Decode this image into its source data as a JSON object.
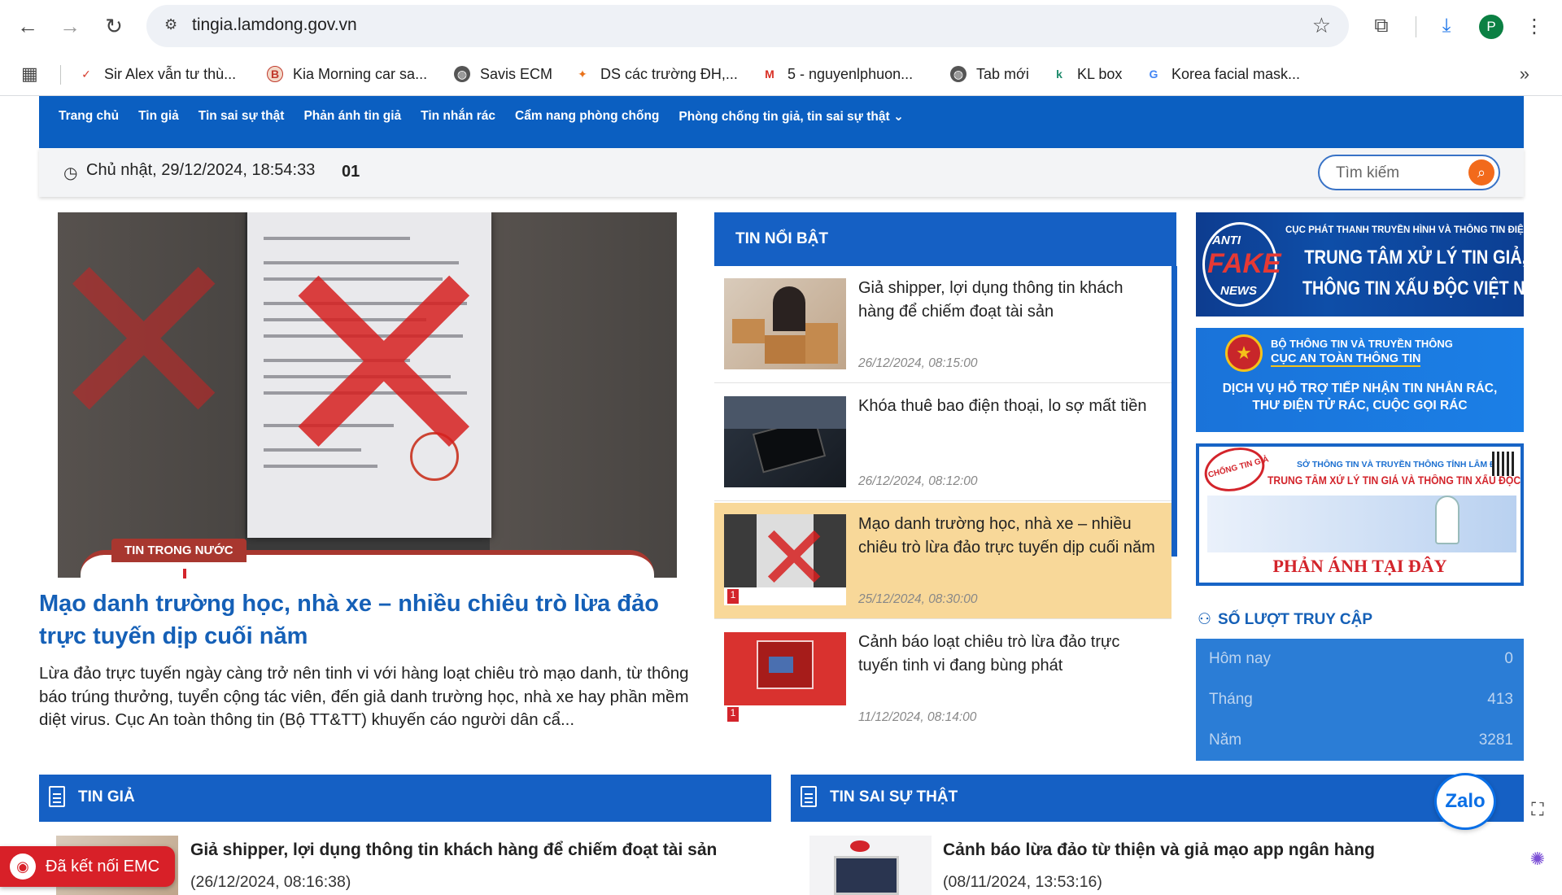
{
  "browser": {
    "url": "tingia.lamdong.gov.vn",
    "profile_initial": "P",
    "bookmarks": [
      {
        "label": "Sir Alex vẫn tư thù...",
        "icon": "check-icon"
      },
      {
        "label": "Kia Morning car sa...",
        "icon": "b-icon"
      },
      {
        "label": "Savis ECM",
        "icon": "globe-icon"
      },
      {
        "label": "DS các trường ĐH,...",
        "icon": "flame-icon"
      },
      {
        "label": "5 - nguyenlphuon...",
        "icon": "gmail-icon"
      },
      {
        "label": "Tab mới",
        "icon": "globe-icon"
      },
      {
        "label": "KL box",
        "icon": "k-icon"
      },
      {
        "label": "Korea facial mask...",
        "icon": "google-icon"
      }
    ]
  },
  "menu": [
    "Trang chủ",
    "Tin giả",
    "Tin sai sự thật",
    "Phản ánh tin giả",
    "Tin nhắn rác",
    "Cẩm nang phòng chống",
    "Phòng chống tin giả, tin sai sự thật"
  ],
  "datebar": {
    "datetime": "Chủ nhật, 29/12/2024, 18:54:33",
    "counter": "01",
    "search_placeholder": "Tìm kiếm"
  },
  "feature": {
    "category": "TIN TRONG NƯỚC",
    "title": "Mạo danh trường học, nhà xe – nhiều chiêu trò lừa đảo trực tuyến dịp cuối năm",
    "description": "Lừa đảo trực tuyến ngày càng trở nên tinh vi với hàng loạt chiêu trò mạo danh, từ thông báo trúng thưởng, tuyển cộng tác viên, đến giả danh trường học, nhà xe hay phần mềm diệt virus. Cục An toàn thông tin (Bộ TT&TT) khuyến cáo người dân cẩ..."
  },
  "highlights": {
    "heading": "TIN NỔI BẬT",
    "items": [
      {
        "title": "Giả shipper, lợi dụng thông tin khách hàng để chiếm đoạt tài sản",
        "date": "26/12/2024, 08:15:00",
        "active": false
      },
      {
        "title": "Khóa thuê bao điện thoại, lo sợ mất tiền",
        "date": "26/12/2024, 08:12:00",
        "active": false
      },
      {
        "title": "Mạo danh trường học, nhà xe – nhiều chiêu trò lừa đảo trực tuyến dịp cuối năm",
        "date": "25/12/2024, 08:30:00",
        "active": true
      },
      {
        "title": "Cảnh báo loạt chiêu trò lừa đảo trực tuyến tinh vi đang bùng phát",
        "date": "11/12/2024, 08:14:00",
        "active": false
      }
    ]
  },
  "banners": {
    "b1_logo_top": "ANTI",
    "b1_logo_mid": "FAKE",
    "b1_logo_bot": "NEWS",
    "b1_small": "CỤC PHÁT THANH TRUYỀN HÌNH VÀ THÔNG TIN ĐIỆN TỬ",
    "b1_big1": "TRUNG TÂM XỬ LÝ TIN GIẢ,",
    "b1_big2": "THÔNG TIN XẤU ĐỘC VIỆT NAM",
    "b2_small": "BỘ THÔNG TIN VÀ TRUYỀN THÔNG",
    "b2_org": "CỤC AN TOÀN THÔNG TIN",
    "b2_line1": "DỊCH VỤ HỖ TRỢ TIẾP NHẬN TIN NHẮN RÁC,",
    "b2_line2": "THƯ ĐIỆN TỬ RÁC, CUỘC GỌI RÁC",
    "b3_small": "SỞ THÔNG TIN VÀ TRUYỀN THÔNG TỈNH LÂM ĐỒNG",
    "b3_title": "TRUNG TÂM XỬ LÝ TIN GIẢ VÀ THÔNG TIN XẤU ĐỘC",
    "b3_stamp": "CHỐNG TIN GIẢ",
    "b3_cta": "PHẢN ÁNH TẠI ĐÂY"
  },
  "visits": {
    "heading": "SỐ LƯỢT TRUY CẬP",
    "rows": [
      {
        "label": "Hôm nay",
        "value": "0"
      },
      {
        "label": "Tháng",
        "value": "413"
      },
      {
        "label": "Năm",
        "value": "3281"
      }
    ]
  },
  "sections": {
    "left": {
      "heading": "TIN GIẢ",
      "title": "Giả shipper, lợi dụng thông tin khách hàng để chiếm đoạt tài sản",
      "date": "(26/12/2024, 08:16:38)"
    },
    "right": {
      "heading": "TIN SAI SỰ THẬT",
      "title": "Cảnh báo lừa đảo từ thiện và giả mạo app ngân hàng",
      "date": "(08/11/2024, 13:53:16)"
    }
  },
  "overlays": {
    "emc_label": "Đã kết nối EMC",
    "zalo_label": "Zalo"
  },
  "colors": {
    "primary": "#1560c4",
    "accent": "#d82028",
    "highlight": "#f8d899"
  }
}
